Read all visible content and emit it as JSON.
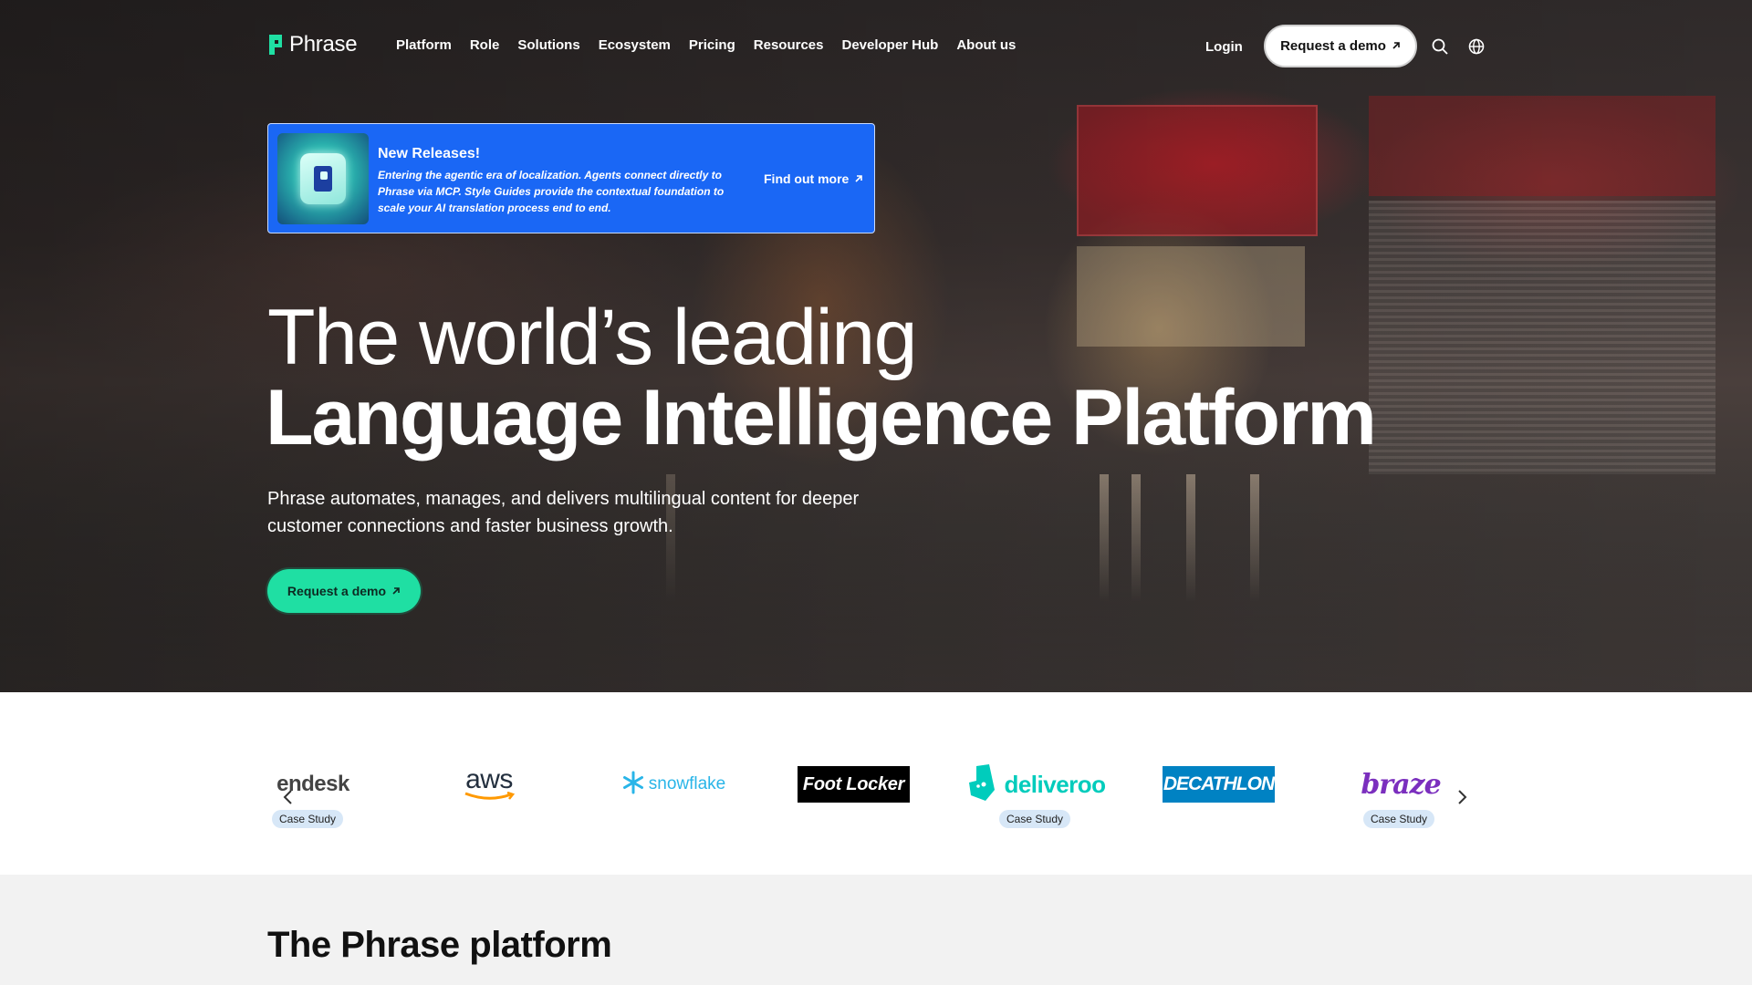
{
  "brand": {
    "name": "Phrase",
    "accent": "#1fdfa3",
    "banner_color": "#1a67f5"
  },
  "nav": {
    "items": [
      "Platform",
      "Role",
      "Solutions",
      "Ecosystem",
      "Pricing",
      "Resources",
      "Developer Hub",
      "About us"
    ],
    "login": "Login",
    "demo": "Request a demo",
    "icons": [
      "search-icon",
      "globe-icon"
    ]
  },
  "banner": {
    "title": "New Releases!",
    "description": "Entering the agentic era of localization. Agents connect directly to Phrase via MCP. Style Guides provide the contextual foundation to scale your AI translation process end to end.",
    "link": "Find out more"
  },
  "hero": {
    "headline_1": "The world’s leading",
    "headline_2": "Language Intelligence Platform",
    "subtitle": "Phrase automates, manages, and delivers multilingual content for deeper customer connections and faster business growth.",
    "cta": "Request a demo"
  },
  "logos": {
    "items": [
      {
        "name": "zendesk",
        "text": "endesk",
        "case_study": "Case Study"
      },
      {
        "name": "aws",
        "text": "aws"
      },
      {
        "name": "snowflake",
        "text": "snowflake"
      },
      {
        "name": "foot-locker",
        "text": "Foot Locker"
      },
      {
        "name": "deliveroo",
        "text": "deliveroo",
        "case_study": "Case Study"
      },
      {
        "name": "decathlon",
        "text": "DECATHLON"
      },
      {
        "name": "braze",
        "text": "braze",
        "case_study": "Case Study"
      }
    ]
  },
  "platform": {
    "title": "The Phrase platform"
  }
}
